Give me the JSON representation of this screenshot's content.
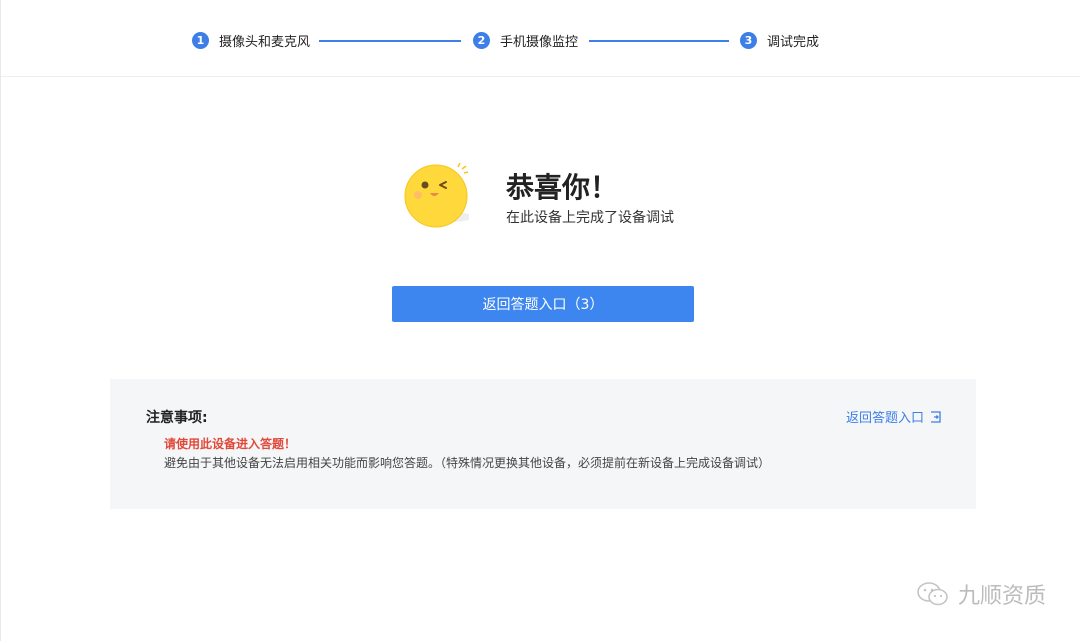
{
  "steps": [
    {
      "number": "1",
      "label": "摄像头和麦克风"
    },
    {
      "number": "2",
      "label": "手机摄像监控"
    },
    {
      "number": "3",
      "label": "调试完成"
    }
  ],
  "result": {
    "title": "恭喜你！",
    "subtitle": "在此设备上完成了设备调试"
  },
  "primary_button": {
    "label": "返回答题入口（3）"
  },
  "notice": {
    "title": "注意事项:",
    "warning": "请使用此设备进入答题！",
    "body": "避免由于其他设备无法启用相关功能而影响您答题。（特殊情况更换其他设备，必须提前在新设备上完成设备调试）",
    "link_label": "返回答题入口"
  },
  "watermark": {
    "text": "九顺资质"
  },
  "colors": {
    "accent": "#3d7fe6",
    "warning": "#e04a3a",
    "notice_bg": "#f5f6f8"
  }
}
